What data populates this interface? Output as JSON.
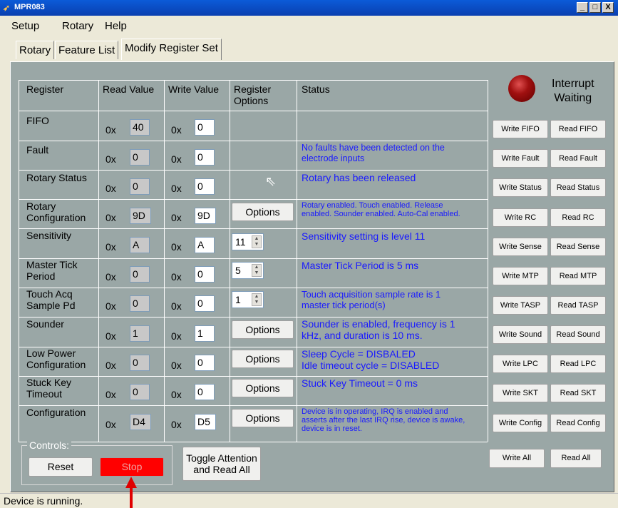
{
  "window": {
    "title": "MPR083",
    "minimize": "_",
    "restore": "□",
    "close": "X"
  },
  "menu": [
    "Setup",
    "Rotary",
    "Help"
  ],
  "tabs": [
    "Rotary",
    "Feature List",
    "Modify Register Set"
  ],
  "headers": {
    "register": "Register",
    "read_value": "Read Value",
    "write_value": "Write Value",
    "register_options_1": "Register",
    "register_options_2": "Options",
    "status": "Status"
  },
  "interrupt": {
    "line1": "Interrupt",
    "line2": "Waiting"
  },
  "prefix": "0x",
  "rows": [
    {
      "label1": "FIFO",
      "label2": "",
      "read": "40",
      "write": "0",
      "option": "",
      "spin": "",
      "status1": "",
      "status2": "",
      "status3": "",
      "write_btn": "Write FIFO",
      "read_btn": "Read FIFO"
    },
    {
      "label1": "Fault",
      "label2": "",
      "read": "0",
      "write": "0",
      "option": "",
      "spin": "",
      "status1": "No faults have been detected on the",
      "status2": "electrode inputs",
      "status3": "",
      "write_btn": "Write Fault",
      "read_btn": "Read Fault"
    },
    {
      "label1": "Rotary Status",
      "label2": "",
      "read": "0",
      "write": "0",
      "option": "",
      "spin": "",
      "status1": "Rotary has been released",
      "status2": "",
      "status3": "",
      "write_btn": "Write Status",
      "read_btn": "Read Status"
    },
    {
      "label1": "Rotary",
      "label2": "Configuration",
      "read": "9D",
      "write": "9D",
      "option": "Options",
      "spin": "",
      "status1": "Rotary enabled. Touch enabled. Release",
      "status2": "enabled. Sounder enabled. Auto-Cal enabled.",
      "status3": "",
      "write_btn": "Write RC",
      "read_btn": "Read RC"
    },
    {
      "label1": "Sensitivity",
      "label2": "",
      "read": "A",
      "write": "A",
      "option": "",
      "spin": "11",
      "status1": "Sensitivity setting is level 11",
      "status2": "",
      "status3": "",
      "write_btn": "Write Sense",
      "read_btn": "Read Sense"
    },
    {
      "label1": "Master Tick",
      "label2": "Period",
      "read": "0",
      "write": "0",
      "option": "",
      "spin": "5",
      "status1": "Master Tick Period is 5 ms",
      "status2": "",
      "status3": "",
      "write_btn": "Write MTP",
      "read_btn": "Read MTP"
    },
    {
      "label1": "Touch Acq",
      "label2": "Sample Pd",
      "read": "0",
      "write": "0",
      "option": "",
      "spin": "1",
      "status1": "Touch acquisition sample rate is 1",
      "status2": "master tick period(s)",
      "status3": "",
      "write_btn": "Write TASP",
      "read_btn": "Read TASP"
    },
    {
      "label1": "Sounder",
      "label2": "",
      "read": "1",
      "write": "1",
      "option": "Options",
      "spin": "",
      "status1": "Sounder is enabled, frequency is 1",
      "status2": "kHz, and duration is 10 ms.",
      "status3": "",
      "write_btn": "Write Sound",
      "read_btn": "Read Sound"
    },
    {
      "label1": "Low Power",
      "label2": "Configuration",
      "read": "0",
      "write": "0",
      "option": "Options",
      "spin": "",
      "status1": "Sleep Cycle = DISBALED",
      "status2": "Idle timeout cycle = DISABLED",
      "status3": "",
      "write_btn": "Write LPC",
      "read_btn": "Read LPC"
    },
    {
      "label1": "Stuck Key",
      "label2": "Timeout",
      "read": "0",
      "write": "0",
      "option": "Options",
      "spin": "",
      "status1": "Stuck Key Timeout = 0 ms",
      "status2": "",
      "status3": "",
      "write_btn": "Write SKT",
      "read_btn": "Read SKT"
    },
    {
      "label1": "Configuration",
      "label2": "",
      "read": "D4",
      "write": "D5",
      "option": "Options",
      "spin": "",
      "status1": "Device is in operating, IRQ is enabled and",
      "status2": "asserts after the last IRQ rise, device is awake,",
      "status3": "device is in reset.",
      "write_btn": "Write Config",
      "read_btn": "Read Config"
    }
  ],
  "controls": {
    "label": "Controls:",
    "reset": "Reset",
    "stop": "Stop",
    "toggle1": "Toggle Attention",
    "toggle2": "and Read All",
    "write_all": "Write All",
    "read_all": "Read All"
  },
  "statusbar": "Device is running.",
  "colors": {
    "panel": "#9aa7a6",
    "status_text": "#1a1aff",
    "stop": "#ff0000",
    "led": "#a01010"
  }
}
